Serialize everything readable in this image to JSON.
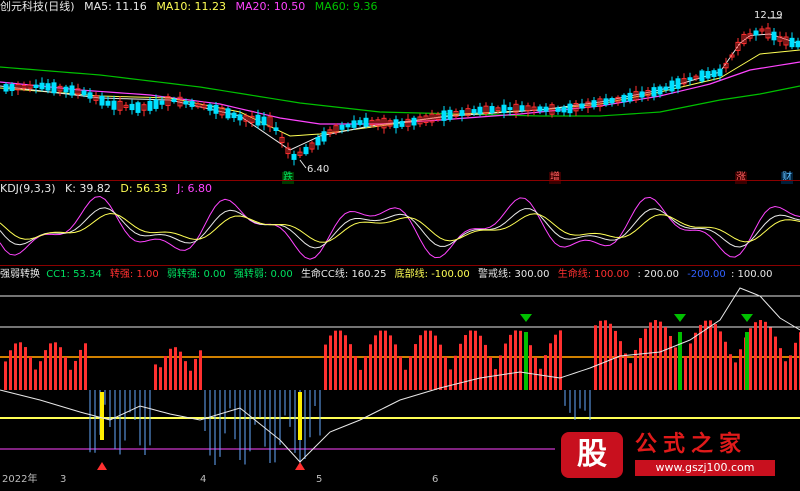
{
  "colors": {
    "bg": "#000000",
    "up": "#ff3030",
    "down": "#00e0ff",
    "white": "#e8e8e8",
    "yellow": "#ffff55",
    "magenta": "#ff44ff",
    "green": "#00c000",
    "sep": "#8b0000"
  },
  "main": {
    "title": "创元科技(日线)",
    "ma5": "MA5: 11.16",
    "ma10": "MA10: 11.23",
    "ma20": "MA20: 10.50",
    "ma60": "MA60: 9.36",
    "high_label": "12.19",
    "low_label": "6.40",
    "events": [
      "跌",
      "增",
      "涨",
      "财"
    ]
  },
  "kdj": {
    "title": "KDJ(9,3,3)",
    "k": "K: 39.82",
    "d": "D: 56.33",
    "j": "J: 6.80"
  },
  "strength": {
    "title": "强弱转换",
    "cc1": "CC1: 53.34",
    "zhuanqiang": "转强: 1.00",
    "ruozhuanqiang": "弱转强: 0.00",
    "qiangzhuanruo": "强转弱: 0.00",
    "shengming_cc": "生命CC线: 160.25",
    "dibu": "底部线: -100.00",
    "jingjie": "警戒线: 300.00",
    "shengming": "生命线: 100.00",
    "v200": ": 200.00",
    "vneg200": "-200.00",
    "v100": ": 100.00"
  },
  "dates": [
    "2022年",
    "3",
    "4",
    "5",
    "6"
  ],
  "watermark": {
    "logo": "股",
    "text": "公式之家",
    "url": "www.gszj100.com"
  }
}
